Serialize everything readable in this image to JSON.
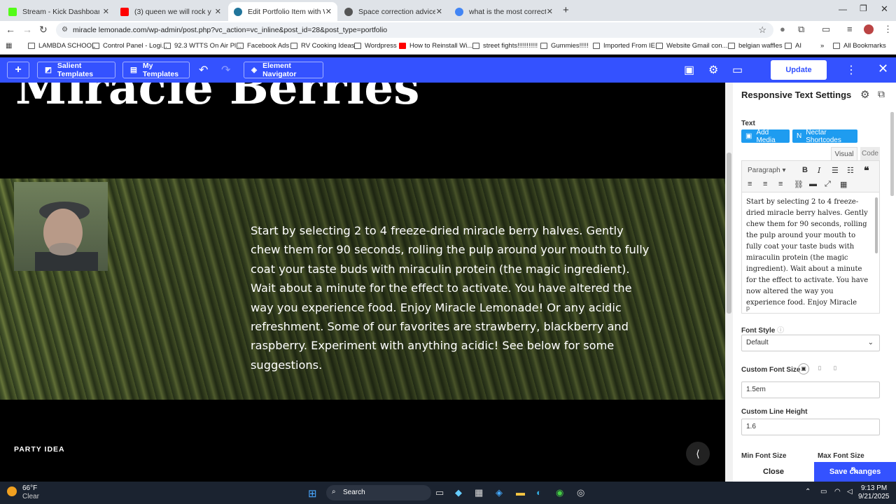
{
  "browser": {
    "tabs": [
      {
        "title": "Stream - Kick Dashboard",
        "color": "#53fc18"
      },
      {
        "title": "(3) queen we will rock you",
        "color": "#ff0000"
      },
      {
        "title": "Edit Portfolio Item with WPBake",
        "color": "#21759b"
      },
      {
        "title": "Space correction advice",
        "color": "#555555"
      },
      {
        "title": "what is the most correct way to",
        "color": "#4285f4"
      }
    ],
    "url": "miracle lemonade.com/wp-admin/post.php?vc_action=vc_inline&post_id=28&post_type=portfolio",
    "bookmarks": [
      "LAMBDA SCHOOL",
      "Control Panel - Logi...",
      "92.3 WTTS On Air Pl...",
      "Facebook Ads",
      "RV Cooking Ideas",
      "Wordpress",
      "How to Reinstall Wi...",
      "street fights!!!!!!!!!!!",
      "Gummies!!!!!",
      "Imported From IE",
      "Website Gmail con...",
      "belgian waffles",
      "AI"
    ],
    "all_bookmarks": "All Bookmarks"
  },
  "wpbar": {
    "salient_templates": "Salient Templates",
    "my_templates": "My Templates",
    "element_navigator": "Element Navigator",
    "update": "Update",
    "accent": "#3452ff"
  },
  "page": {
    "heading": "Miracle Berries",
    "body": "Start by selecting 2 to 4 freeze-dried miracle berry halves. Gently chew them for 90 seconds, rolling the pulp around your mouth to fully coat your taste buds with miraculin protein (the magic ingredient). Wait about a minute for the effect to activate. You have altered the way you experience food. Enjoy Miracle Lemonade! Or any acidic refreshment. Some of our favorites are strawberry, blackberry and raspberry. Experiment with anything acidic! See below for some suggestions.",
    "section_label": "PARTY IDEA"
  },
  "panel": {
    "title": "Responsive Text Settings",
    "text_label": "Text",
    "add_media": "Add Media",
    "nectar_shortcodes": "Nectar Shortcodes",
    "tab_visual": "Visual",
    "tab_code": "Code",
    "format_select": "Paragraph",
    "editor_text": "Start by selecting 2 to 4 freeze-dried miracle berry halves. Gently chew them for 90 seconds, rolling the pulp around your mouth to fully coat your taste buds with miraculin protein (the magic ingredient). Wait about a minute for the effect to activate. You have now altered the way you experience food. Enjoy Miracle",
    "editor_path": "p",
    "font_style_label": "Font Style",
    "font_style_value": "Default",
    "custom_font_size_label": "Custom Font Size",
    "custom_font_size_value": "1.5em",
    "custom_line_height_label": "Custom Line Height",
    "custom_line_height_value": "1.6",
    "min_font_size_label": "Min Font Size",
    "max_font_size_label": "Max Font Size",
    "close": "Close",
    "save_changes": "Save changes"
  },
  "taskbar": {
    "temp": "66°F",
    "weather": "Clear",
    "search": "Search",
    "time": "9:13 PM",
    "date": "9/21/2025"
  }
}
